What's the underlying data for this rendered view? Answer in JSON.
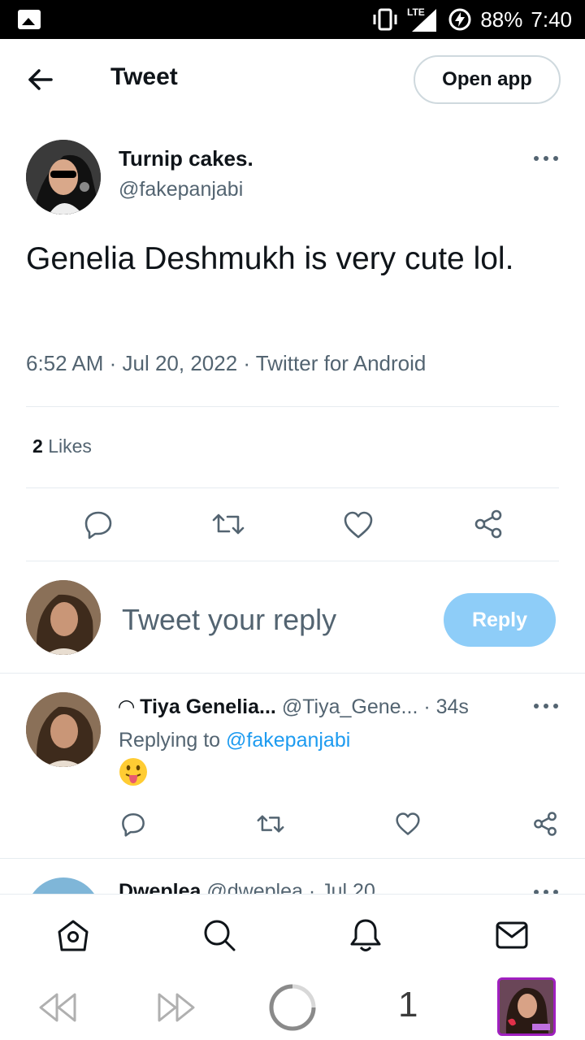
{
  "status_bar": {
    "battery": "88%",
    "time": "7:40",
    "network": "LTE"
  },
  "header": {
    "title": "Tweet",
    "open_app_label": "Open app"
  },
  "tweet": {
    "author_name": "Turnip cakes.",
    "author_handle": "@fakepanjabi",
    "text": "Genelia Deshmukh is very cute lol.",
    "meta": "6:52 AM · Jul 20, 2022 · Twitter for Android",
    "likes_count": "2",
    "likes_label": "Likes"
  },
  "composer": {
    "placeholder": "Tweet your reply",
    "reply_label": "Reply"
  },
  "reply": {
    "name": "◠ Tiya Genelia...",
    "handle": "@Tiya_Gene...",
    "time": "· 34s",
    "replying_prefix": "Replying to",
    "replying_to": "@fakepanjabi",
    "emoji": "😛"
  },
  "next_reply": {
    "name": "Dweplea",
    "handle": "@dweplea",
    "time": "· Jul 20"
  },
  "sys_nav": {
    "tab_count": "1"
  },
  "colors": {
    "accent": "#1d9bf0",
    "reply_button": "#8ecdf8",
    "text_secondary": "#536471"
  }
}
